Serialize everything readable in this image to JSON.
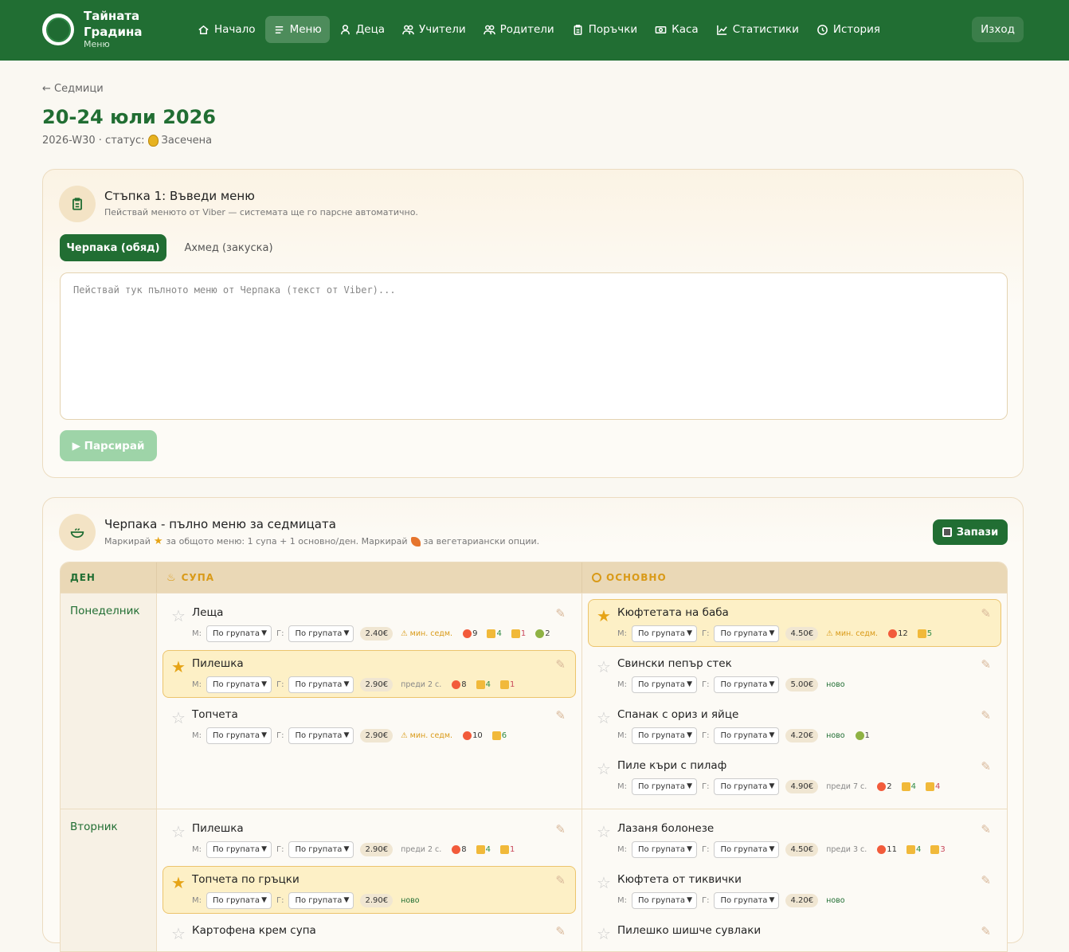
{
  "brand": {
    "name": "Тайната Градина",
    "subtitle": "Меню"
  },
  "nav": [
    {
      "label": "Начало",
      "icon": "home-icon",
      "active": false
    },
    {
      "label": "Меню",
      "icon": "menu-icon",
      "active": true
    },
    {
      "label": "Деца",
      "icon": "user-icon",
      "active": false
    },
    {
      "label": "Учители",
      "icon": "users-icon",
      "active": false
    },
    {
      "label": "Родители",
      "icon": "users-icon",
      "active": false
    },
    {
      "label": "Поръчки",
      "icon": "clipboard-icon",
      "active": false
    },
    {
      "label": "Каса",
      "icon": "cash-icon",
      "active": false
    },
    {
      "label": "Статистики",
      "icon": "chart-icon",
      "active": false
    },
    {
      "label": "История",
      "icon": "history-icon",
      "active": false
    }
  ],
  "logout": "Изход",
  "back": "← Седмици",
  "week_title": "20-24 юли 2026",
  "week_meta": {
    "code": "2026-W30 · статус:",
    "status": "Засечена"
  },
  "step1": {
    "title": "Стъпка 1: Въведи меню",
    "subtitle": "Пействай менюто от Viber — системата ще го парсне автоматично.",
    "tab_active": "Черпака (обяд)",
    "tab_inactive": "Ахмед (закуска)",
    "placeholder": "Пействай тук пълното меню от Черпака (текст от Viber)...",
    "parse_button": "▶ Парсирай"
  },
  "menu_card": {
    "title": "Черпака - пълно меню за седмицата",
    "subtitle_a": "Маркирай",
    "subtitle_b": "за общото меню: 1 супа + 1 основно/ден. Маркирай",
    "subtitle_c": "за вегетариански опции.",
    "save_button": "Запази",
    "headers": {
      "day": "ДЕН",
      "soup": "СУПА",
      "main": "ОСНОВНО"
    },
    "m_label": "М:",
    "g_label": "Г:",
    "select_value": "По групата"
  },
  "days": [
    {
      "day": "Понеделник",
      "soups": [
        {
          "name": "Леща",
          "selected": false,
          "price": "2.40€",
          "note": "⚠ мин. седм.",
          "note_type": "warn",
          "badges": [
            {
              "t": "love",
              "v": "9"
            },
            {
              "t": "up",
              "v": "4"
            },
            {
              "t": "down",
              "v": "1"
            },
            {
              "t": "sick",
              "v": "2"
            }
          ]
        },
        {
          "name": "Пилешка",
          "selected": true,
          "price": "2.90€",
          "note": "преди 2 с.",
          "note_type": "note",
          "badges": [
            {
              "t": "love",
              "v": "8"
            },
            {
              "t": "up",
              "v": "4"
            },
            {
              "t": "down",
              "v": "1"
            }
          ]
        },
        {
          "name": "Топчета",
          "selected": false,
          "price": "2.90€",
          "note": "⚠ мин. седм.",
          "note_type": "warn",
          "badges": [
            {
              "t": "love",
              "v": "10"
            },
            {
              "t": "up",
              "v": "6"
            }
          ]
        }
      ],
      "mains": [
        {
          "name": "Кюфтетата на баба",
          "selected": true,
          "price": "4.50€",
          "note": "⚠ мин. седм.",
          "note_type": "warn",
          "badges": [
            {
              "t": "love",
              "v": "12"
            },
            {
              "t": "up",
              "v": "5"
            }
          ]
        },
        {
          "name": "Свински пепър стек",
          "selected": false,
          "price": "5.00€",
          "note": "ново",
          "note_type": "new",
          "badges": []
        },
        {
          "name": "Спанак с ориз и яйце",
          "selected": false,
          "price": "4.20€",
          "note": "ново",
          "note_type": "new",
          "badges": [
            {
              "t": "sick",
              "v": "1"
            }
          ]
        },
        {
          "name": "Пиле къри с пилаф",
          "selected": false,
          "price": "4.90€",
          "note": "преди 7 с.",
          "note_type": "note",
          "badges": [
            {
              "t": "love",
              "v": "2"
            },
            {
              "t": "up",
              "v": "4"
            },
            {
              "t": "down",
              "v": "4"
            }
          ]
        }
      ]
    },
    {
      "day": "Вторник",
      "soups": [
        {
          "name": "Пилешка",
          "selected": false,
          "price": "2.90€",
          "note": "преди 2 с.",
          "note_type": "note",
          "badges": [
            {
              "t": "love",
              "v": "8"
            },
            {
              "t": "up",
              "v": "4"
            },
            {
              "t": "down",
              "v": "1"
            }
          ]
        },
        {
          "name": "Топчета по гръцки",
          "selected": true,
          "price": "2.90€",
          "note": "ново",
          "note_type": "new",
          "badges": []
        },
        {
          "name": "Картофена крем супа",
          "selected": false,
          "price": "",
          "note": "",
          "note_type": "note",
          "badges": []
        }
      ],
      "mains": [
        {
          "name": "Лазаня болонезе",
          "selected": false,
          "price": "4.50€",
          "note": "преди 3 с.",
          "note_type": "note",
          "badges": [
            {
              "t": "love",
              "v": "11"
            },
            {
              "t": "up",
              "v": "4"
            },
            {
              "t": "down",
              "v": "3"
            }
          ]
        },
        {
          "name": "Кюфтета от тиквички",
          "selected": false,
          "price": "4.20€",
          "note": "ново",
          "note_type": "new",
          "badges": []
        },
        {
          "name": "Пилешко шишче сувлаки",
          "selected": false,
          "price": "",
          "note": "",
          "note_type": "note",
          "badges": []
        }
      ]
    }
  ]
}
